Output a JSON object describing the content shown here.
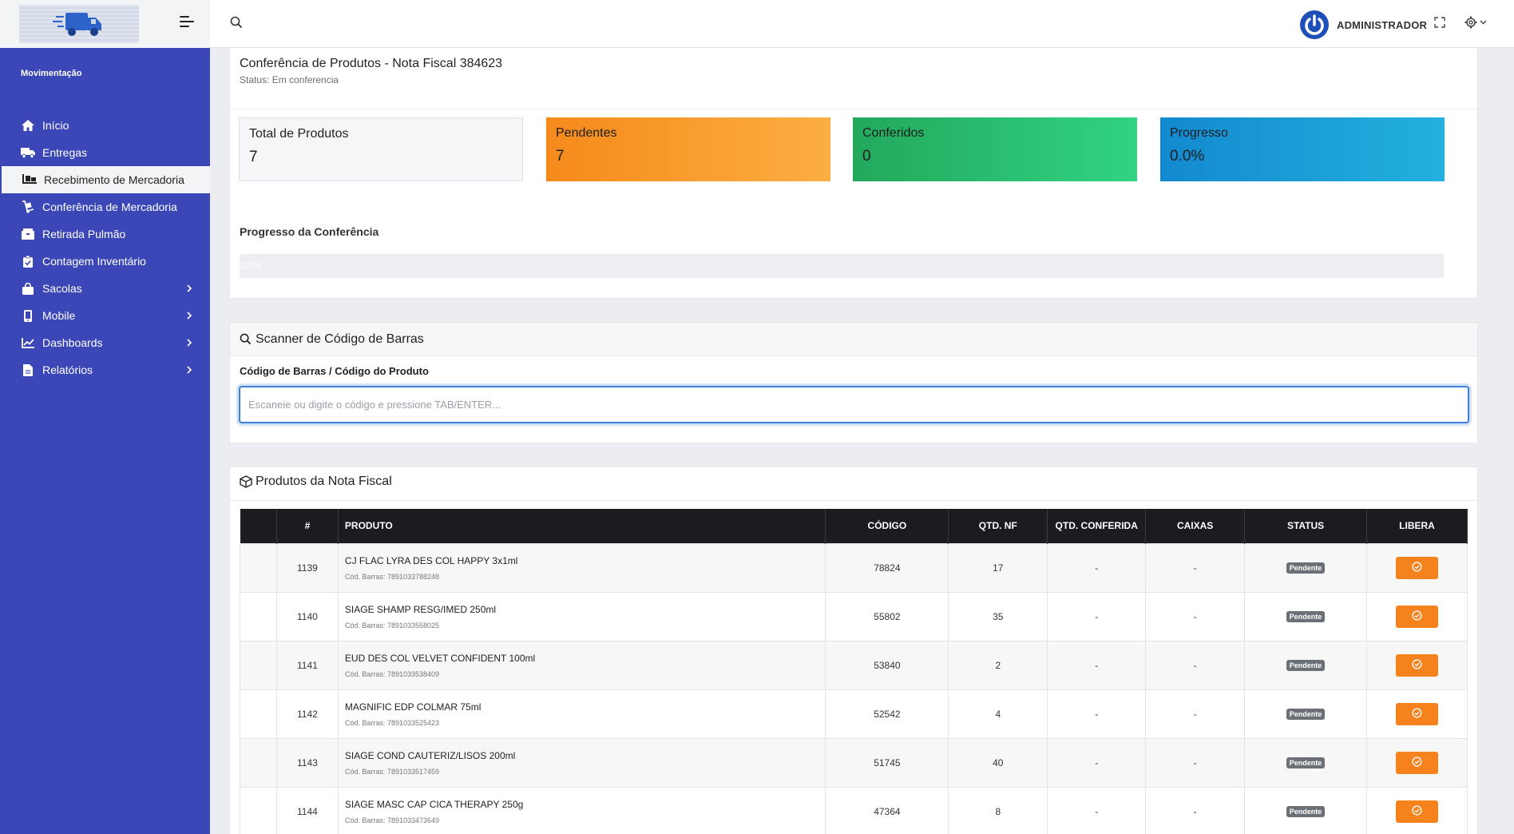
{
  "topbar": {
    "user_name": "ADMINISTRADOR"
  },
  "sidebar": {
    "section": "Movimentação",
    "items": [
      {
        "label": "Início",
        "icon": "home-icon"
      },
      {
        "label": "Entregas",
        "icon": "truck-icon"
      },
      {
        "label": "Recebimento de Mercadoria",
        "icon": "pallet-icon",
        "active": true
      },
      {
        "label": "Conferência de Mercadoria",
        "icon": "dolly-icon"
      },
      {
        "label": "Retirada Pulmão",
        "icon": "boxes-icon"
      },
      {
        "label": "Contagem Inventário",
        "icon": "clipboard-check-icon"
      },
      {
        "label": "Sacolas",
        "icon": "shopping-bag-icon",
        "has_submenu": true
      },
      {
        "label": "Mobile",
        "icon": "mobile-icon",
        "has_submenu": true
      },
      {
        "label": "Dashboards",
        "icon": "chart-line-icon",
        "has_submenu": true
      },
      {
        "label": "Relatórios",
        "icon": "file-icon",
        "has_submenu": true
      }
    ]
  },
  "header": {
    "title": "Conferência de Produtos - Nota Fiscal 384623",
    "status": "Status: Em conferencia"
  },
  "stats": {
    "total": {
      "label": "Total de Produtos",
      "value": "7"
    },
    "pendentes": {
      "label": "Pendentes",
      "value": "7"
    },
    "conferidos": {
      "label": "Conferidos",
      "value": "0"
    },
    "progresso": {
      "label": "Progresso",
      "value": "0.0%"
    }
  },
  "progress": {
    "label": "Progresso da Conferência",
    "text": "0.0%",
    "fraction": 0.0
  },
  "scanner": {
    "title": "Scanner de Código de Barras",
    "field_label": "Código de Barras / Código do Produto",
    "placeholder": "Escaneie ou digite o código e pressione TAB/ENTER...",
    "value": ""
  },
  "products": {
    "title": "Produtos da Nota Fiscal",
    "columns": [
      "",
      "#",
      "PRODUTO",
      "CÓDIGO",
      "QTD. NF",
      "QTD. CONFERIDA",
      "CAIXAS",
      "STATUS",
      "LIBERA"
    ],
    "barcode_prefix": "Cód. Barras:",
    "rows": [
      {
        "id": "1139",
        "name": "CJ FLAC LYRA DES COL HAPPY 3x1ml",
        "barcode": "7891033788248",
        "code": "78824",
        "qtd_nf": "17",
        "qtd_conf": "-",
        "caixas": "-",
        "status": "Pendente"
      },
      {
        "id": "1140",
        "name": "SIAGE SHAMP RESG/IMED 250ml",
        "barcode": "7891033558025",
        "code": "55802",
        "qtd_nf": "35",
        "qtd_conf": "-",
        "caixas": "-",
        "status": "Pendente"
      },
      {
        "id": "1141",
        "name": "EUD DES COL VELVET CONFIDENT 100ml",
        "barcode": "7891033538409",
        "code": "53840",
        "qtd_nf": "2",
        "qtd_conf": "-",
        "caixas": "-",
        "status": "Pendente"
      },
      {
        "id": "1142",
        "name": "MAGNIFIC EDP COLMAR 75ml",
        "barcode": "7891033525423",
        "code": "52542",
        "qtd_nf": "4",
        "qtd_conf": "-",
        "caixas": "-",
        "status": "Pendente"
      },
      {
        "id": "1143",
        "name": "SIAGE COND CAUTERIZ/LISOS 200ml",
        "barcode": "7891033517459",
        "code": "51745",
        "qtd_nf": "40",
        "qtd_conf": "-",
        "caixas": "-",
        "status": "Pendente"
      },
      {
        "id": "1144",
        "name": "SIAGE MASC CAP CICA THERAPY 250g",
        "barcode": "7891033473649",
        "code": "47364",
        "qtd_nf": "8",
        "qtd_conf": "-",
        "caixas": "-",
        "status": "Pendente"
      }
    ]
  },
  "colors": {
    "sidebar": "#3b47b7",
    "pendentes": "#f58a1b",
    "conferidos": "#23a85d",
    "progresso": "#1389cf",
    "libera_button": "#f6821d"
  }
}
